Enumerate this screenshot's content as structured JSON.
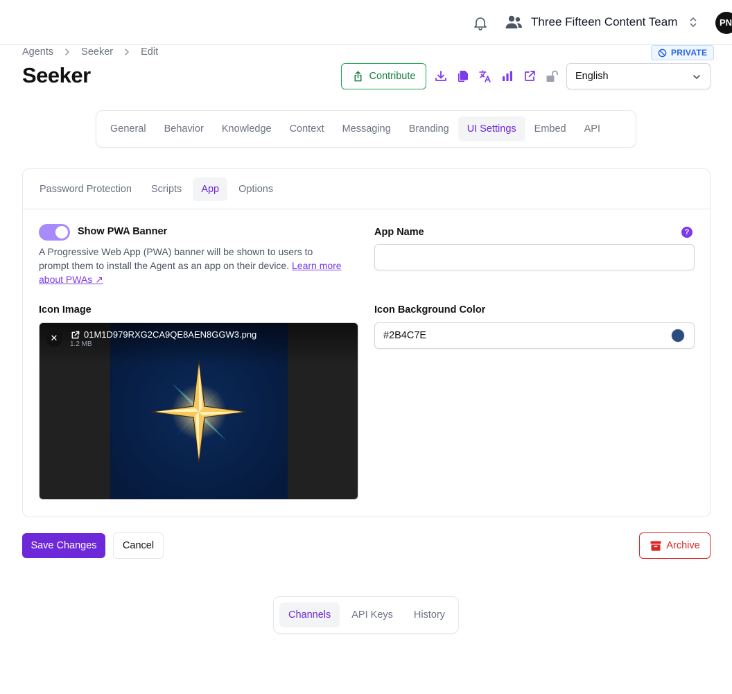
{
  "header": {
    "team_name": "Three Fifteen Content Team",
    "avatar_initials": "PN"
  },
  "breadcrumb": [
    "Agents",
    "Seeker",
    "Edit"
  ],
  "badge": {
    "label": "PRIVATE"
  },
  "page": {
    "title": "Seeker"
  },
  "toolbar": {
    "contribute_label": "Contribute",
    "language_value": "English",
    "icons": [
      "download-icon",
      "copy-icon",
      "translate-icon",
      "analytics-icon",
      "external-link-icon",
      "unlock-icon"
    ]
  },
  "main_tabs": [
    {
      "label": "General"
    },
    {
      "label": "Behavior"
    },
    {
      "label": "Knowledge"
    },
    {
      "label": "Context"
    },
    {
      "label": "Messaging"
    },
    {
      "label": "Branding"
    },
    {
      "label": "UI Settings",
      "active": true
    },
    {
      "label": "Embed"
    },
    {
      "label": "API"
    }
  ],
  "sub_tabs": [
    {
      "label": "Password Protection"
    },
    {
      "label": "Scripts"
    },
    {
      "label": "App",
      "active": true
    },
    {
      "label": "Options"
    }
  ],
  "app": {
    "pwa_toggle_label": "Show PWA Banner",
    "pwa_toggle_on": true,
    "pwa_desc": "A Progressive Web App (PWA) banner will be shown to users to prompt them to install the Agent as an app on their device.",
    "pwa_link_text": "Learn more about PWAs ↗",
    "app_name_label": "App Name",
    "app_name_value": "",
    "icon_image_label": "Icon Image",
    "icon_file_name": "01M1D979RXG2CA9QE8AEN8GGW3.png",
    "icon_file_size": "1.2 MB",
    "icon_bg_label": "Icon Background Color",
    "icon_bg_value": "#2B4C7E"
  },
  "actions": {
    "save_label": "Save Changes",
    "cancel_label": "Cancel",
    "archive_label": "Archive"
  },
  "bottom_tabs": [
    {
      "label": "Channels",
      "active": true
    },
    {
      "label": "API Keys"
    },
    {
      "label": "History"
    }
  ],
  "colors": {
    "accent": "#6d28d9",
    "success": "#16a34a",
    "danger": "#dc2626",
    "info": "#2563eb"
  }
}
